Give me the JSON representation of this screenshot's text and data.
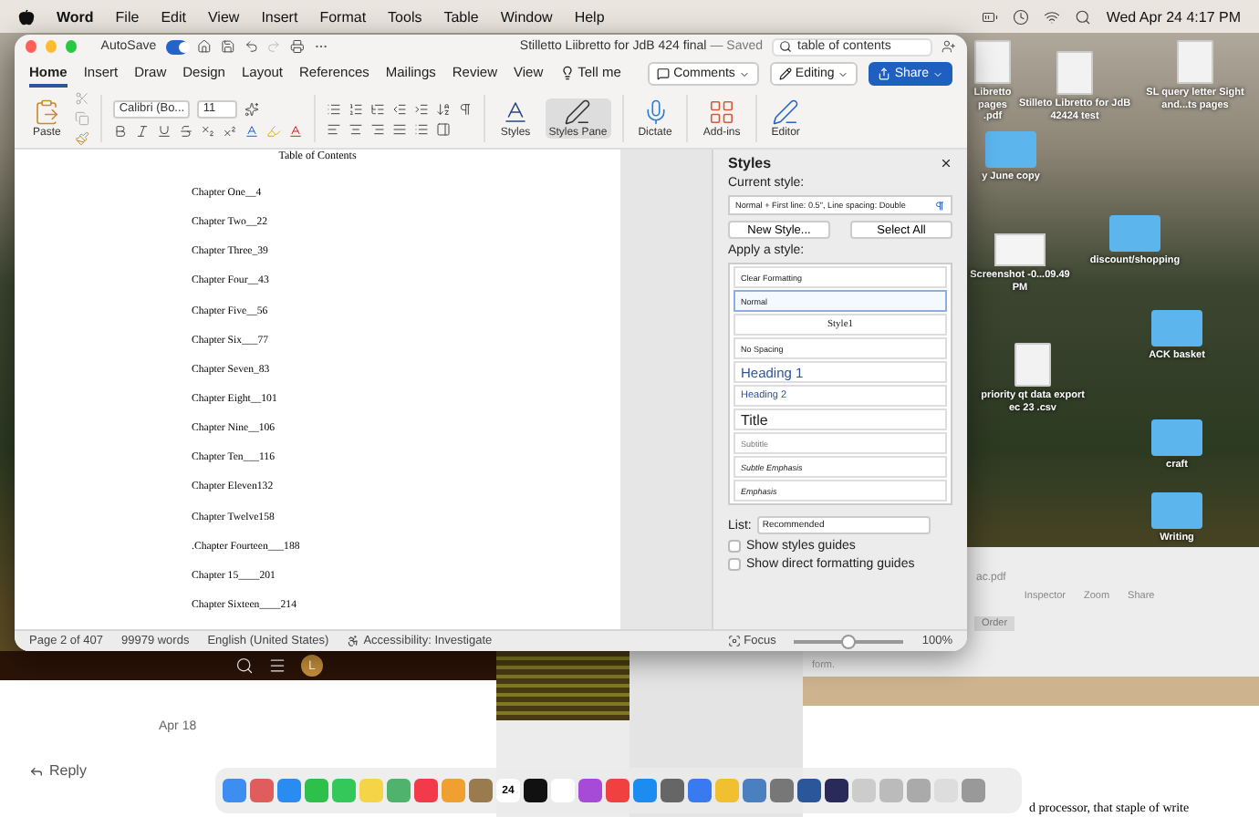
{
  "menu_bar": {
    "app": "Word",
    "items": [
      "File",
      "Edit",
      "View",
      "Insert",
      "Format",
      "Tools",
      "Table",
      "Window",
      "Help"
    ],
    "clock": "Wed Apr 24  4:17 PM"
  },
  "word_window": {
    "autosave": {
      "label": "AutoSave",
      "on": true
    },
    "title": "Stilletto Liibretto for JdB 424 final",
    "saved": "— Saved",
    "search": {
      "value": "table of contents"
    },
    "tabs": [
      {
        "label": "Home",
        "selected": true
      },
      {
        "label": "Insert",
        "selected": false
      },
      {
        "label": "Draw",
        "selected": false
      },
      {
        "label": "Design",
        "selected": false
      },
      {
        "label": "Layout",
        "selected": false
      },
      {
        "label": "References",
        "selected": false
      },
      {
        "label": "Mailings",
        "selected": false
      },
      {
        "label": "Review",
        "selected": false
      },
      {
        "label": "View",
        "selected": false
      }
    ],
    "tell_me": "Tell me",
    "comments": "Comments",
    "editing": "Editing",
    "share": "Share",
    "ribbon": {
      "paste": "Paste",
      "font": "Calibri (Bo...",
      "size": "11",
      "styles": "Styles",
      "styles_pane": "Styles Pane",
      "dictate": "Dictate",
      "addins": "Add-ins",
      "editor": "Editor"
    },
    "document": {
      "heading": "Table of Contents",
      "entries": [
        "Chapter One__4",
        "Chapter Two__22",
        "Chapter Three_39",
        "Chapter Four__43",
        "Chapter Five__56",
        "Chapter Six___77",
        "Chapter Seven_83",
        "Chapter Eight__101",
        "Chapter Nine__106",
        "Chapter Ten___116",
        "Chapter Eleven132",
        "Chapter Twelve158",
        ".Chapter Fourteen___188",
        "Chapter 15____201",
        "Chapter Sixteen____214"
      ]
    },
    "styles_pane": {
      "title": "Styles",
      "current_label": "Current style:",
      "current": "Normal + First line:  0.5\", Line spacing:  Double",
      "new_style": "New Style...",
      "select_all": "Select All",
      "apply_label": "Apply a style:",
      "styles": [
        {
          "label": "Clear Formatting",
          "kind": "clear",
          "selected": false
        },
        {
          "label": "Normal",
          "kind": "plain",
          "selected": true
        },
        {
          "label": "Style1",
          "kind": "centered",
          "selected": false
        },
        {
          "label": "No Spacing",
          "kind": "plain",
          "selected": false
        },
        {
          "label": "Heading 1",
          "kind": "heading1",
          "selected": false
        },
        {
          "label": "Heading 2",
          "kind": "heading2",
          "selected": false
        },
        {
          "label": "Title",
          "kind": "title",
          "selected": false
        },
        {
          "label": "Subtitle",
          "kind": "subtle",
          "selected": false
        },
        {
          "label": "Subtle Emphasis",
          "kind": "italic",
          "selected": false
        },
        {
          "label": "Emphasis",
          "kind": "italic",
          "selected": false
        }
      ],
      "list_label": "List:",
      "list_value": "Recommended",
      "options": [
        {
          "label": "Show styles guides",
          "checked": false
        },
        {
          "label": "Show direct formatting guides",
          "checked": false
        }
      ]
    },
    "status_bar": {
      "page": "Page 2 of 407",
      "words": "99979 words",
      "language": "English (United States)",
      "accessibility": "Accessibility: Investigate",
      "focus": "Focus",
      "zoom": "100%",
      "zoom_slider": {
        "level": 0.5
      }
    }
  },
  "desktop_icons": [
    {
      "label": "Libretto pages .pdf",
      "kind": "file"
    },
    {
      "label": "Stilleto Libretto for JdB 42424 test",
      "kind": "file"
    },
    {
      "label": "SL query letter Sight and...ts pages",
      "kind": "doc"
    },
    {
      "label": "y June copy",
      "kind": "folder"
    },
    {
      "label": "discount/shopping",
      "kind": "folder"
    },
    {
      "label": "Screenshot -0...09.49 PM",
      "kind": "shot"
    },
    {
      "label": "priority qt data export ec 23 .csv",
      "kind": "file"
    },
    {
      "label": "ACK basket",
      "kind": "folder"
    },
    {
      "label": "craft",
      "kind": "folder"
    },
    {
      "label": "Writing",
      "kind": "folder"
    }
  ],
  "browser": {
    "avatar": "L",
    "date": "Apr 18",
    "reply": "Reply"
  },
  "preview": {
    "file": "ac.pdf",
    "tools": [
      "Inspector",
      "Zoom",
      "Share"
    ],
    "order": "Order",
    "note": "form.",
    "body": "d processor, that staple of write"
  },
  "dock": {
    "calendar_day": "24"
  }
}
